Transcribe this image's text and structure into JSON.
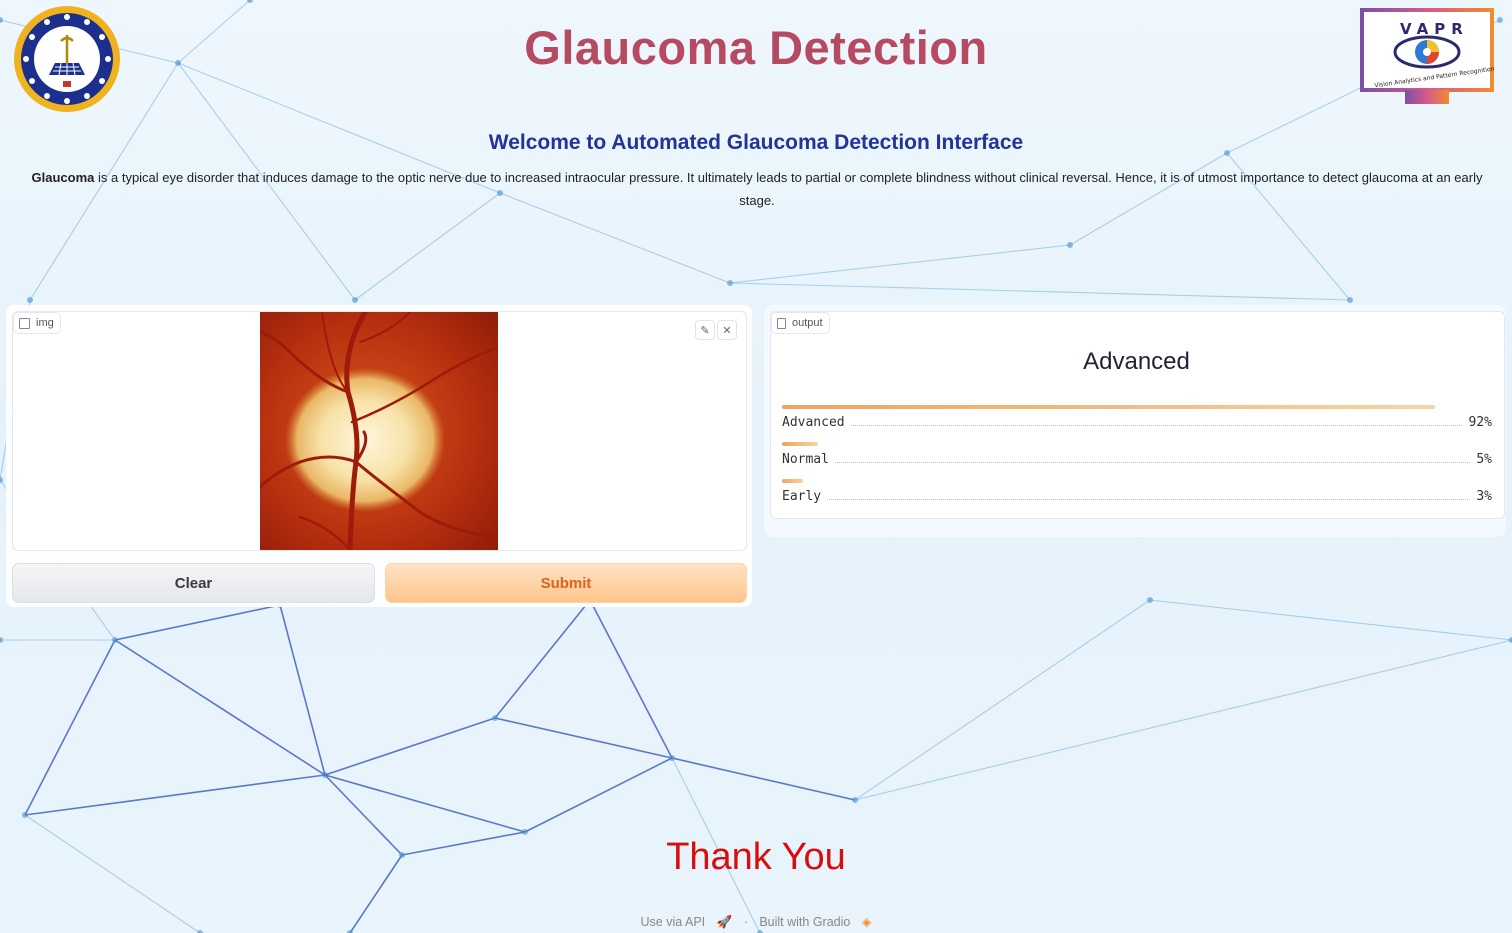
{
  "header": {
    "title": "Glaucoma Detection",
    "welcome": "Welcome to Automated Glaucoma Detection Interface",
    "description_bold": "Glaucoma",
    "description_rest": " is a typical eye disorder that induces damage to the optic nerve due to increased intraocular pressure. It ultimately leads to partial or complete blindness without clinical reversal. Hence, it is of utmost importance to detect glaucoma at an early stage."
  },
  "logos": {
    "right_logo_text": "VAPR",
    "right_logo_subtext": "Vision Analytics and Pattern Recognition Lab"
  },
  "input_panel": {
    "label": "img",
    "clear_label": "Clear",
    "submit_label": "Submit"
  },
  "output_panel": {
    "label": "output",
    "top_label": "Advanced",
    "confidences": [
      {
        "label": "Advanced",
        "percent": "92%",
        "value": 0.92
      },
      {
        "label": "Normal",
        "percent": "5%",
        "value": 0.05
      },
      {
        "label": "Early",
        "percent": "3%",
        "value": 0.03
      }
    ]
  },
  "thanks": "Thank You",
  "footer": {
    "api_link": "Use via API",
    "separator": "·",
    "built_with": "Built with Gradio"
  },
  "colors": {
    "title": "#b54a60",
    "welcome": "#22339b",
    "thanks": "#d90d0d",
    "submit_text": "#d9651e"
  }
}
